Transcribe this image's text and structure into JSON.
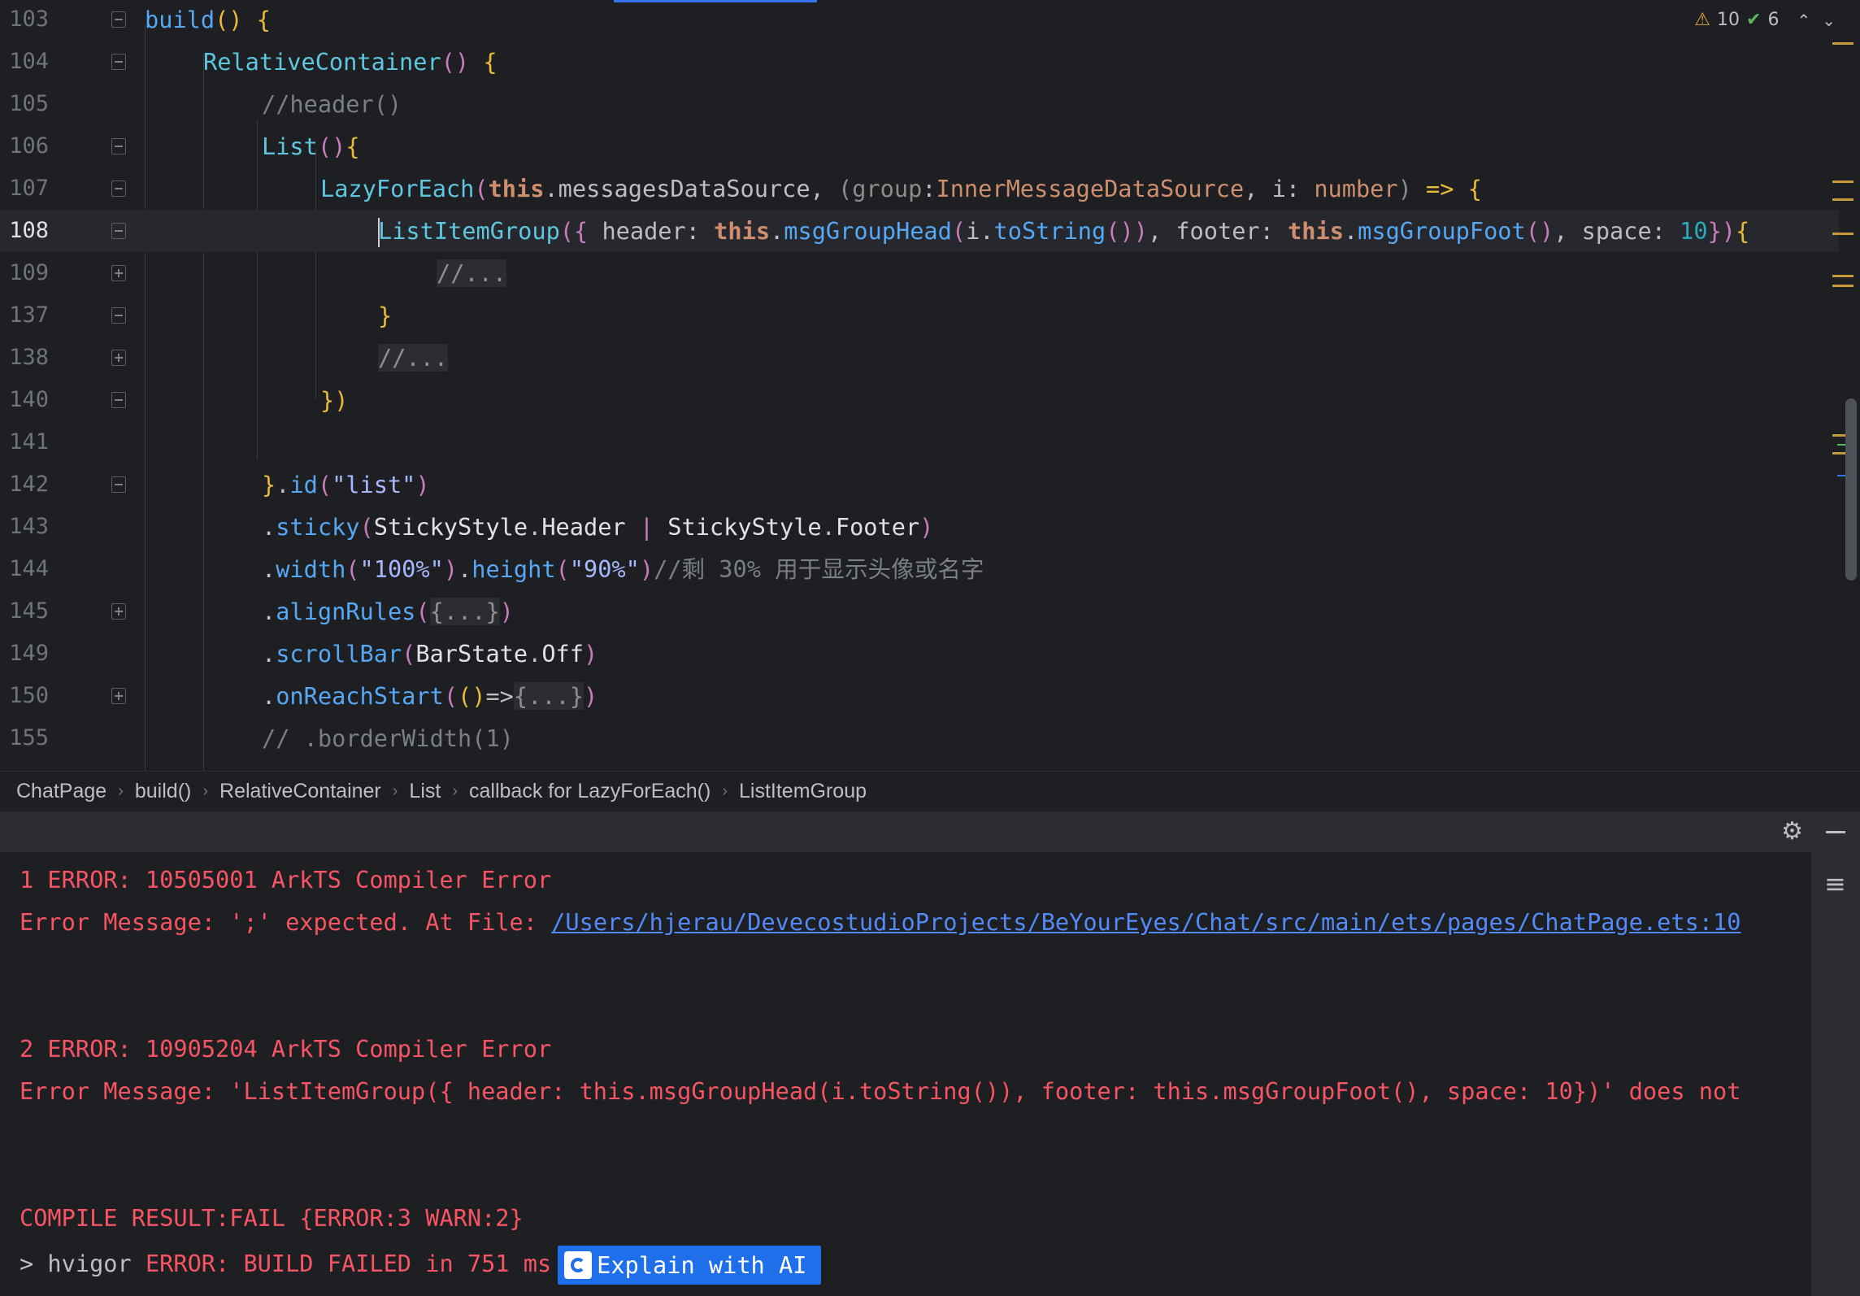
{
  "editor": {
    "lines": [
      {
        "num": "103",
        "fold": "open"
      },
      {
        "num": "104",
        "fold": "open"
      },
      {
        "num": "105",
        "fold": ""
      },
      {
        "num": "106",
        "fold": "open"
      },
      {
        "num": "107",
        "fold": "open"
      },
      {
        "num": "108",
        "fold": "open",
        "current": true
      },
      {
        "num": "109",
        "fold": "plus"
      },
      {
        "num": "137",
        "fold": "open"
      },
      {
        "num": "138",
        "fold": "plus"
      },
      {
        "num": "140",
        "fold": "open"
      },
      {
        "num": "141",
        "fold": ""
      },
      {
        "num": "142",
        "fold": "open"
      },
      {
        "num": "143",
        "fold": ""
      },
      {
        "num": "144",
        "fold": ""
      },
      {
        "num": "145",
        "fold": "plus"
      },
      {
        "num": "149",
        "fold": ""
      },
      {
        "num": "150",
        "fold": "plus"
      },
      {
        "num": "155",
        "fold": ""
      }
    ],
    "code": {
      "l103_a": "build",
      "l103_b": "() ",
      "l103_c": "{",
      "l104_a": "RelativeContainer",
      "l104_b": "() ",
      "l104_c": "{",
      "l105": "//header()",
      "l106_a": "List",
      "l106_b": "()",
      "l106_c": "{",
      "l107_a": "LazyForEach",
      "l107_b": "(",
      "l107_this": "this",
      "l107_c": ".messagesDataSource, ",
      "l107_d": "(",
      "l107_grp": "group",
      "l107_e": ":",
      "l107_ty": "InnerMessageDataSource",
      "l107_f": ", i: ",
      "l107_num": "number",
      "l107_g": ") ",
      "l107_arrow": "=>",
      "l107_h": " {",
      "l108_a": "ListItemGroup",
      "l108_b": "({",
      "l108_c": " header: ",
      "l108_this1": "this",
      "l108_d": ".",
      "l108_fn1": "msgGroupHead",
      "l108_e": "(",
      "l108_f": "i.",
      "l108_fn2": "toString",
      "l108_g": "()",
      "l108_h": ")",
      "l108_i": ", footer: ",
      "l108_this2": "this",
      "l108_j": ".",
      "l108_fn3": "msgGroupFoot",
      "l108_k": "()",
      "l108_l": ", space: ",
      "l108_num": "10",
      "l108_m": "})",
      "l108_n": "{",
      "l109": "//...",
      "l137": "}",
      "l138": "//...",
      "l140": "})",
      "l142_a": "}",
      "l142_b": ".",
      "l142_fn": "id",
      "l142_c": "(",
      "l142_str": "\"list\"",
      "l142_d": ")",
      "l143_a": ".",
      "l143_fn": "sticky",
      "l143_b": "(",
      "l143_c": "StickyStyle",
      "l143_d": ".",
      "l143_e": "Header",
      "l143_f": " | ",
      "l143_g": "StickyStyle",
      "l143_h": ".",
      "l143_i": "Footer",
      "l143_j": ")",
      "l144_a": ".",
      "l144_fn1": "width",
      "l144_b": "(",
      "l144_str1": "\"100%\"",
      "l144_c": ")",
      "l144_d": ".",
      "l144_fn2": "height",
      "l144_e": "(",
      "l144_str2": "\"90%\"",
      "l144_f": ")",
      "l144_cm": "//剩 30% 用于显示头像或名字",
      "l145_a": ".",
      "l145_fn": "alignRules",
      "l145_b": "(",
      "l145_fold": "{...}",
      "l145_c": ")",
      "l149_a": ".",
      "l149_fn": "scrollBar",
      "l149_b": "(",
      "l149_c": "BarState",
      "l149_d": ".",
      "l149_e": "Off",
      "l149_f": ")",
      "l150_a": ".",
      "l150_fn": "onReachStart",
      "l150_b": "(",
      "l150_c": "()",
      "l150_arrow": "=>",
      "l150_fold": "{...}",
      "l150_d": ")",
      "l155": "// .borderWidth(1)"
    },
    "inspections": {
      "warnings": "10",
      "ok": "6"
    }
  },
  "breadcrumb": [
    "ChatPage",
    "build()",
    "RelativeContainer",
    "List",
    "callback for LazyForEach()",
    "ListItemGroup"
  ],
  "console": {
    "l1": "1 ERROR: 10505001 ArkTS Compiler Error",
    "l2_prefix": "Error Message: ';' expected. At File: ",
    "l2_link": "/Users/hjerau/DevecostudioProjects/BeYourEyes/Chat/src/main/ets/pages/ChatPage.ets:10",
    "l3": "2 ERROR: 10905204 ArkTS Compiler Error",
    "l4": "Error Message: 'ListItemGroup({ header: this.msgGroupHead(i.toString()), footer: this.msgGroupFoot(), space: 10})' does not",
    "l5": "COMPILE RESULT:FAIL {ERROR:3 WARN:2}",
    "l6_prompt": "> hvigor ",
    "l6_error": "ERROR: BUILD FAILED in 751 ms",
    "ai_button": "Explain with AI"
  },
  "colors": {
    "accent": "#3574f0",
    "error": "#f75464",
    "link": "#548af7",
    "ai_button": "#1f6feb"
  }
}
